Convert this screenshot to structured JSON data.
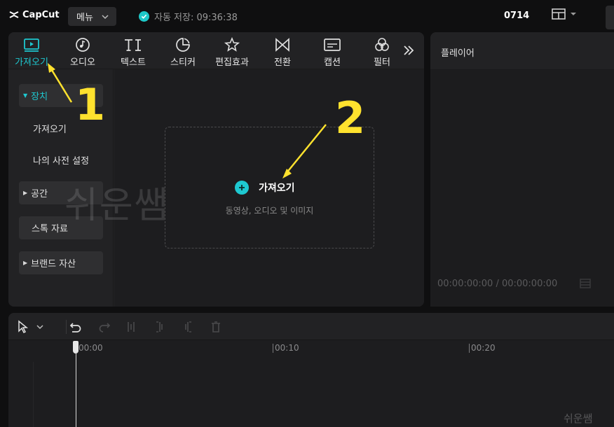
{
  "app": {
    "logo_text": "CapCut"
  },
  "header": {
    "menu_label": "메뉴",
    "autosave_text": "자동 저장: 09:36:38",
    "project_name": "0714"
  },
  "tabs": [
    {
      "label": "가져오기",
      "icon": "media-icon",
      "active": true
    },
    {
      "label": "오디오",
      "icon": "audio-icon"
    },
    {
      "label": "텍스트",
      "icon": "text-icon"
    },
    {
      "label": "스티커",
      "icon": "sticker-icon"
    },
    {
      "label": "편집효과",
      "icon": "effects-icon"
    },
    {
      "label": "전환",
      "icon": "transition-icon"
    },
    {
      "label": "캡션",
      "icon": "caption-icon"
    },
    {
      "label": "필터",
      "icon": "filter-icon"
    }
  ],
  "sidebar": {
    "items": [
      {
        "label": "장치",
        "caret": "▼",
        "active": true
      },
      {
        "label": "가져오기"
      },
      {
        "label": "나의 사전 설정"
      },
      {
        "label": "공간",
        "caret": "▶"
      },
      {
        "label": "스톡 자료"
      },
      {
        "label": "브랜드 자산",
        "caret": "▶"
      }
    ]
  },
  "dropzone": {
    "title": "가져오기",
    "subtitle": "동영상, 오디오 및 이미지"
  },
  "player": {
    "title": "플레이어",
    "timecode": "00:00:00:00 / 00:00:00:00"
  },
  "timeline": {
    "ticks": [
      "00:00",
      "00:10",
      "00:20"
    ]
  },
  "watermark": {
    "text": "쉬운쌤"
  },
  "annotations": {
    "step1": "1",
    "step2": "2"
  },
  "colors": {
    "accent": "#1ec8d0",
    "annotation": "#ffe22e"
  }
}
